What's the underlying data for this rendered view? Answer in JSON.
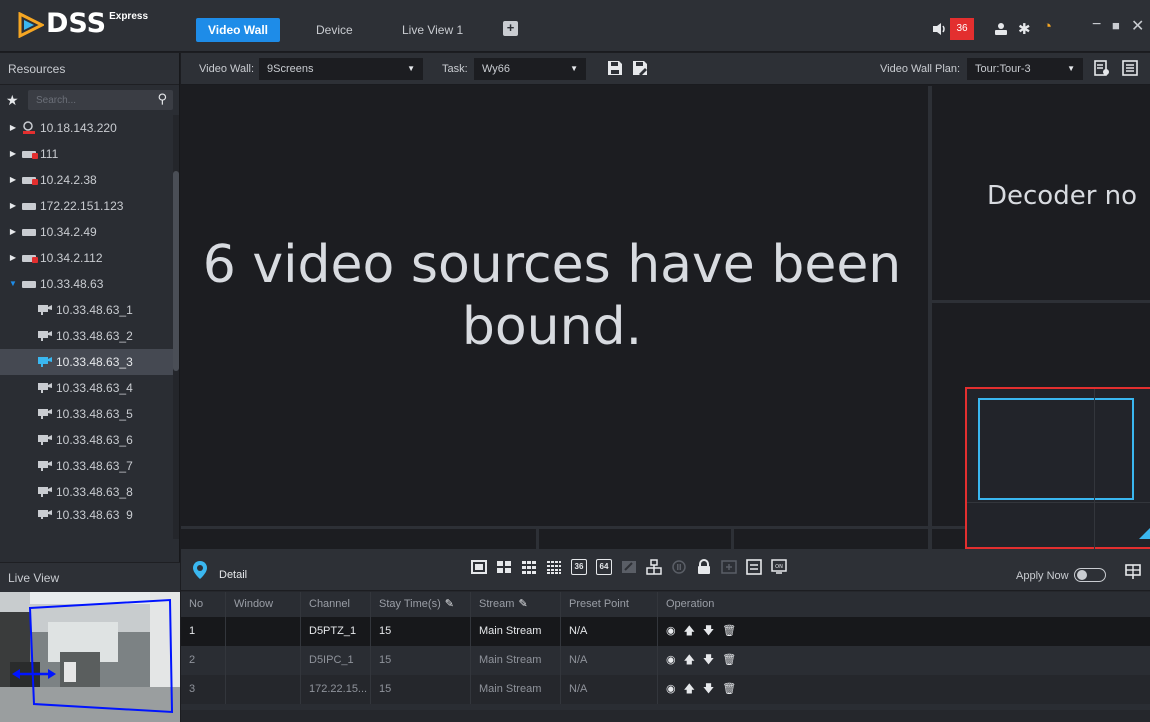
{
  "app": {
    "logo_text": "DSS",
    "logo_sup": "Express",
    "tabs": [
      {
        "label": "Video Wall",
        "active": true
      },
      {
        "label": "Device",
        "active": false
      },
      {
        "label": "Live View 1",
        "active": false
      }
    ],
    "add_tab_symbol": "+",
    "alarm_count": "36",
    "accent_color": "#1e8ce8",
    "alarm_color": "#e32f2f"
  },
  "sidebar": {
    "resources_label": "Resources",
    "search_placeholder": "Search...",
    "tree": [
      {
        "label": "10.18.143.220",
        "expanded": false,
        "icon": "user-group-icon"
      },
      {
        "label": "111",
        "expanded": false,
        "icon": "device-alarm-icon"
      },
      {
        "label": "10.24.2.38",
        "expanded": false,
        "icon": "device-alarm-icon"
      },
      {
        "label": "172.22.151.123",
        "expanded": false,
        "icon": "device-icon"
      },
      {
        "label": "10.34.2.49",
        "expanded": false,
        "icon": "device-icon"
      },
      {
        "label": "10.34.2.112",
        "expanded": false,
        "icon": "device-alarm-icon"
      },
      {
        "label": "10.33.48.63",
        "expanded": true,
        "icon": "device-icon"
      }
    ],
    "channels": [
      {
        "label": "10.33.48.63_1"
      },
      {
        "label": "10.33.48.63_2"
      },
      {
        "label": "10.33.48.63_3",
        "selected": true
      },
      {
        "label": "10.33.48.63_4"
      },
      {
        "label": "10.33.48.63_5"
      },
      {
        "label": "10.33.48.63_6"
      },
      {
        "label": "10.33.48.63_7"
      },
      {
        "label": "10.33.48.63_8"
      },
      {
        "label": "10.33.48.63_9"
      }
    ],
    "live_view_label": "Live View"
  },
  "toolbar": {
    "video_wall_label": "Video Wall:",
    "video_wall_value": "9Screens",
    "task_label": "Task:",
    "task_value": "Wy66",
    "plan_label": "Video Wall Plan:",
    "plan_value": "Tour:Tour-3"
  },
  "wall": {
    "message": "6 video sources have been bound.",
    "decoder_message": "Decoder no"
  },
  "detail": {
    "title": "Detail",
    "apply_now_label": "Apply Now",
    "apply_now_on": false,
    "layout_labels": [
      "36",
      "64"
    ],
    "columns": [
      "No",
      "Window",
      "Channel",
      "Stay Time(s)",
      "Stream",
      "Preset Point",
      "Operation"
    ],
    "rows": [
      {
        "no": "1",
        "window": "",
        "channel": "D5PTZ_1",
        "stay": "15",
        "stream": "Main Stream",
        "preset": "N/A"
      },
      {
        "no": "2",
        "window": "",
        "channel": "D5IPC_1",
        "stay": "15",
        "stream": "Main Stream",
        "preset": "N/A"
      },
      {
        "no": "3",
        "window": "",
        "channel": "172.22.15...",
        "stay": "15",
        "stream": "Main Stream",
        "preset": "N/A"
      }
    ]
  }
}
